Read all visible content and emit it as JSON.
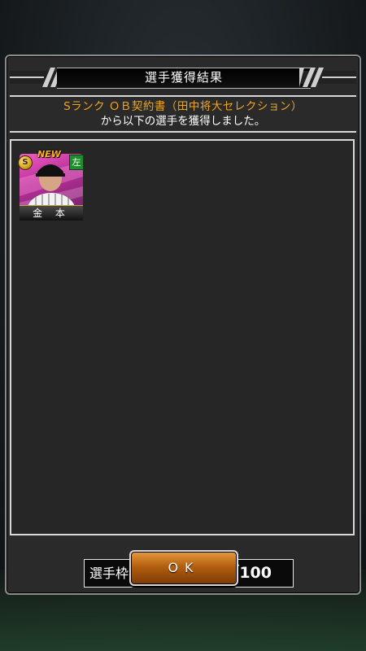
{
  "dialog": {
    "title": "選手獲得結果",
    "message_line1": "Sランク ＯＢ契約書（田中将大セレクション）",
    "message_line2": "から以下の選手を獲得しました。"
  },
  "players": [
    {
      "name": "金 本",
      "rank": "S",
      "new_label": "NEW",
      "hand": "左"
    }
  ],
  "slots": {
    "label": "選手枠：",
    "value": "82／100"
  },
  "buttons": {
    "ok_label": "OK"
  },
  "colors": {
    "highlight": "#f3a51b",
    "button": "#b35f10",
    "hand_badge": "#1e8d2b"
  }
}
